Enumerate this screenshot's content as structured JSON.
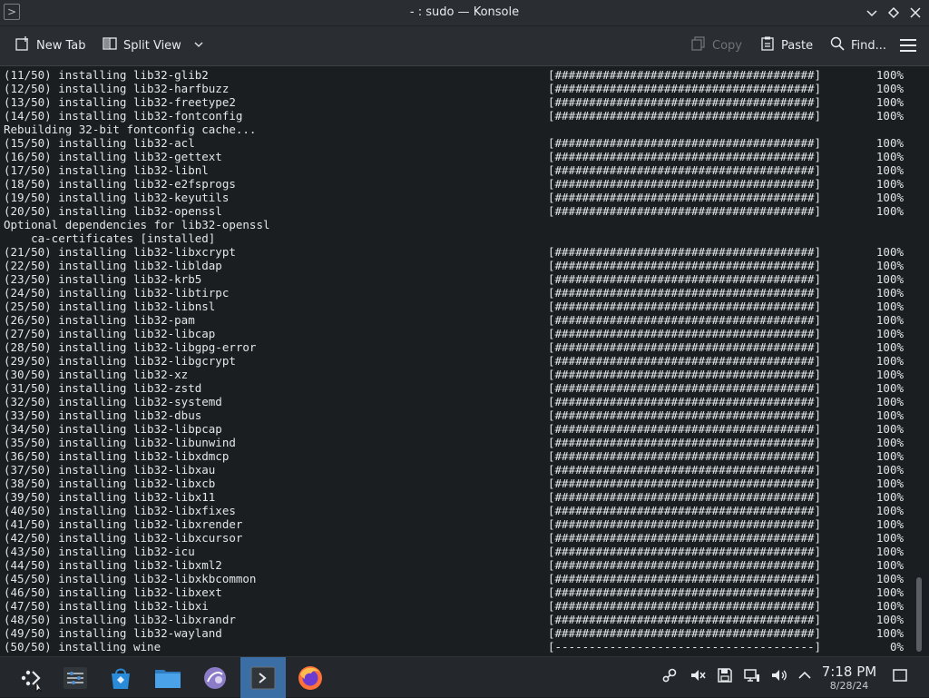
{
  "window": {
    "title": "- : sudo — Konsole",
    "app_icon": "terminal-icon"
  },
  "toolbar": {
    "new_tab": "New Tab",
    "split_view": "Split View",
    "copy": "Copy",
    "paste": "Paste",
    "find": "Find..."
  },
  "terminal": {
    "lines": [
      {
        "text": "(11/50) installing lib32-glib2",
        "bar": "[######################################]",
        "pct": "100%"
      },
      {
        "text": "(12/50) installing lib32-harfbuzz",
        "bar": "[######################################]",
        "pct": "100%"
      },
      {
        "text": "(13/50) installing lib32-freetype2",
        "bar": "[######################################]",
        "pct": "100%"
      },
      {
        "text": "(14/50) installing lib32-fontconfig",
        "bar": "[######################################]",
        "pct": "100%"
      },
      {
        "text": "Rebuilding 32-bit fontconfig cache...",
        "bar": "",
        "pct": ""
      },
      {
        "text": "(15/50) installing lib32-acl",
        "bar": "[######################################]",
        "pct": "100%"
      },
      {
        "text": "(16/50) installing lib32-gettext",
        "bar": "[######################################]",
        "pct": "100%"
      },
      {
        "text": "(17/50) installing lib32-libnl",
        "bar": "[######################################]",
        "pct": "100%"
      },
      {
        "text": "(18/50) installing lib32-e2fsprogs",
        "bar": "[######################################]",
        "pct": "100%"
      },
      {
        "text": "(19/50) installing lib32-keyutils",
        "bar": "[######################################]",
        "pct": "100%"
      },
      {
        "text": "(20/50) installing lib32-openssl",
        "bar": "[######################################]",
        "pct": "100%"
      },
      {
        "text": "Optional dependencies for lib32-openssl",
        "bar": "",
        "pct": ""
      },
      {
        "text": "    ca-certificates [installed]",
        "bar": "",
        "pct": ""
      },
      {
        "text": "(21/50) installing lib32-libxcrypt",
        "bar": "[######################################]",
        "pct": "100%"
      },
      {
        "text": "(22/50) installing lib32-libldap",
        "bar": "[######################################]",
        "pct": "100%"
      },
      {
        "text": "(23/50) installing lib32-krb5",
        "bar": "[######################################]",
        "pct": "100%"
      },
      {
        "text": "(24/50) installing lib32-libtirpc",
        "bar": "[######################################]",
        "pct": "100%"
      },
      {
        "text": "(25/50) installing lib32-libnsl",
        "bar": "[######################################]",
        "pct": "100%"
      },
      {
        "text": "(26/50) installing lib32-pam",
        "bar": "[######################################]",
        "pct": "100%"
      },
      {
        "text": "(27/50) installing lib32-libcap",
        "bar": "[######################################]",
        "pct": "100%"
      },
      {
        "text": "(28/50) installing lib32-libgpg-error",
        "bar": "[######################################]",
        "pct": "100%"
      },
      {
        "text": "(29/50) installing lib32-libgcrypt",
        "bar": "[######################################]",
        "pct": "100%"
      },
      {
        "text": "(30/50) installing lib32-xz",
        "bar": "[######################################]",
        "pct": "100%"
      },
      {
        "text": "(31/50) installing lib32-zstd",
        "bar": "[######################################]",
        "pct": "100%"
      },
      {
        "text": "(32/50) installing lib32-systemd",
        "bar": "[######################################]",
        "pct": "100%"
      },
      {
        "text": "(33/50) installing lib32-dbus",
        "bar": "[######################################]",
        "pct": "100%"
      },
      {
        "text": "(34/50) installing lib32-libpcap",
        "bar": "[######################################]",
        "pct": "100%"
      },
      {
        "text": "(35/50) installing lib32-libunwind",
        "bar": "[######################################]",
        "pct": "100%"
      },
      {
        "text": "(36/50) installing lib32-libxdmcp",
        "bar": "[######################################]",
        "pct": "100%"
      },
      {
        "text": "(37/50) installing lib32-libxau",
        "bar": "[######################################]",
        "pct": "100%"
      },
      {
        "text": "(38/50) installing lib32-libxcb",
        "bar": "[######################################]",
        "pct": "100%"
      },
      {
        "text": "(39/50) installing lib32-libx11",
        "bar": "[######################################]",
        "pct": "100%"
      },
      {
        "text": "(40/50) installing lib32-libxfixes",
        "bar": "[######################################]",
        "pct": "100%"
      },
      {
        "text": "(41/50) installing lib32-libxrender",
        "bar": "[######################################]",
        "pct": "100%"
      },
      {
        "text": "(42/50) installing lib32-libxcursor",
        "bar": "[######################################]",
        "pct": "100%"
      },
      {
        "text": "(43/50) installing lib32-icu",
        "bar": "[######################################]",
        "pct": "100%"
      },
      {
        "text": "(44/50) installing lib32-libxml2",
        "bar": "[######################################]",
        "pct": "100%"
      },
      {
        "text": "(45/50) installing lib32-libxkbcommon",
        "bar": "[######################################]",
        "pct": "100%"
      },
      {
        "text": "(46/50) installing lib32-libxext",
        "bar": "[######################################]",
        "pct": "100%"
      },
      {
        "text": "(47/50) installing lib32-libxi",
        "bar": "[######################################]",
        "pct": "100%"
      },
      {
        "text": "(48/50) installing lib32-libxrandr",
        "bar": "[######################################]",
        "pct": "100%"
      },
      {
        "text": "(49/50) installing lib32-wayland",
        "bar": "[######################################]",
        "pct": "100%"
      },
      {
        "text": "(50/50) installing wine",
        "bar": "[--------------------------------------]",
        "pct": "0%"
      }
    ]
  },
  "taskbar": {
    "apps": [
      "app-launcher-icon",
      "system-settings-icon",
      "discover-store-icon",
      "file-manager-icon",
      "browser-app-icon",
      "konsole-icon",
      "firefox-icon"
    ],
    "tray": [
      "steam-icon",
      "audio-muted-icon",
      "storage-icon",
      "network-icon",
      "volume-icon",
      "show-hidden-icon"
    ],
    "time": "7:18 PM",
    "date": "8/28/24"
  },
  "colors": {
    "background": "#1b1e20",
    "chrome": "#2a2e32",
    "active_task": "#3a6ea5",
    "text": "#e8eaed"
  }
}
